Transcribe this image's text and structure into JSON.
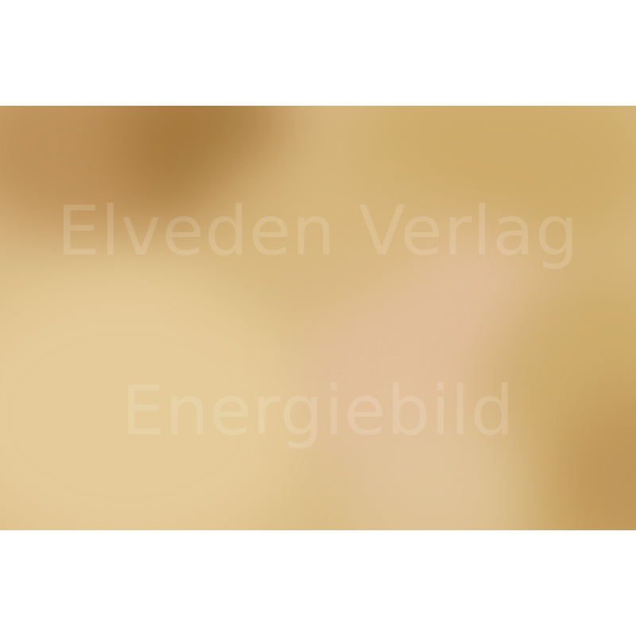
{
  "photo": {
    "description_colors": {
      "base": "#d9bb86",
      "dark_accent": "#9e7137",
      "light_accent": "#e6cd9c"
    }
  },
  "watermark": {
    "line1": "Elveden Verlag",
    "line2": "Energiebild"
  }
}
